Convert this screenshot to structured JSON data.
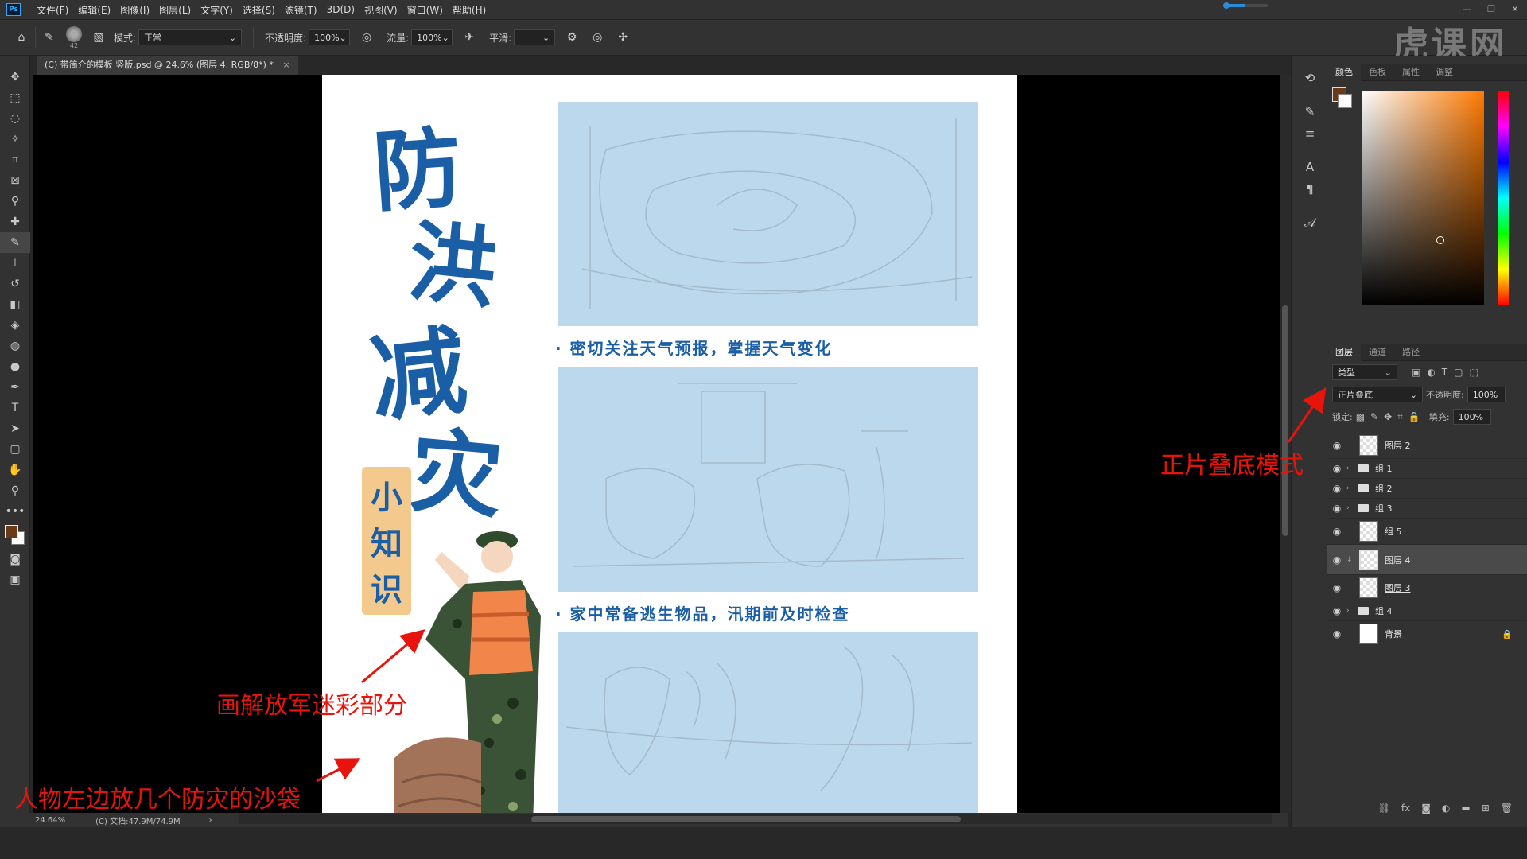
{
  "app": {
    "logo": "Ps"
  },
  "menu": [
    "文件(F)",
    "编辑(E)",
    "图像(I)",
    "图层(L)",
    "文字(Y)",
    "选择(S)",
    "滤镜(T)",
    "3D(D)",
    "视图(V)",
    "窗口(W)",
    "帮助(H)"
  ],
  "window_controls": {
    "minimize": "—",
    "restore": "❐",
    "close": "✕"
  },
  "options": {
    "brush_size": "42",
    "mode_label": "模式:",
    "mode_value": "正常",
    "opacity_label": "不透明度:",
    "opacity_value": "100%",
    "flow_label": "流量:",
    "flow_value": "100%",
    "smooth_label": "平滑:",
    "smooth_value": ""
  },
  "watermark": "虎课网",
  "document": {
    "tab_title": "(C) 带简介的模板 竖版.psd @ 24.6% (图层 4, RGB/8*) *",
    "tab_close": "×",
    "zoom": "24.64%",
    "doc_info": "(C) 文档:47.9M/74.9M"
  },
  "poster": {
    "title_chars": [
      "防",
      "洪",
      "减",
      "灾"
    ],
    "subtitle_chars": [
      "小",
      "知",
      "识"
    ],
    "tip1": "· 密切关注天气预报，掌握天气变化",
    "tip2": "· 家中常备逃生物品，汛期前及时检查"
  },
  "color_panel": {
    "tabs": [
      "颜色",
      "色板",
      "属性",
      "调整"
    ]
  },
  "layers_panel": {
    "tabs": [
      "图层",
      "通道",
      "路径"
    ],
    "filter": "类型",
    "blend_mode": "正片叠底",
    "opacity_label": "不透明度:",
    "opacity_value": "100%",
    "lock_label": "锁定:",
    "fill_label": "填充:",
    "fill_value": "100%",
    "layers": [
      {
        "name": "图层 2",
        "type": "layer"
      },
      {
        "name": "组 1",
        "type": "group"
      },
      {
        "name": "组 2",
        "type": "group"
      },
      {
        "name": "组 3",
        "type": "group"
      },
      {
        "name": "组 5",
        "type": "layer"
      },
      {
        "name": "图层 4",
        "type": "layer",
        "selected": true
      },
      {
        "name": "图层 3",
        "type": "layer"
      },
      {
        "name": "组 4",
        "type": "group"
      },
      {
        "name": "背景",
        "type": "background",
        "locked": true
      }
    ]
  },
  "annotations": {
    "blend": "正片叠底模式",
    "camo": "画解放军迷彩部分",
    "sandbags": "人物左边放几个防灾的沙袋"
  },
  "colors": {
    "accent_blue": "#1a5ea6",
    "annotation_red": "#e8140c",
    "foreground": "#6b3a16"
  }
}
